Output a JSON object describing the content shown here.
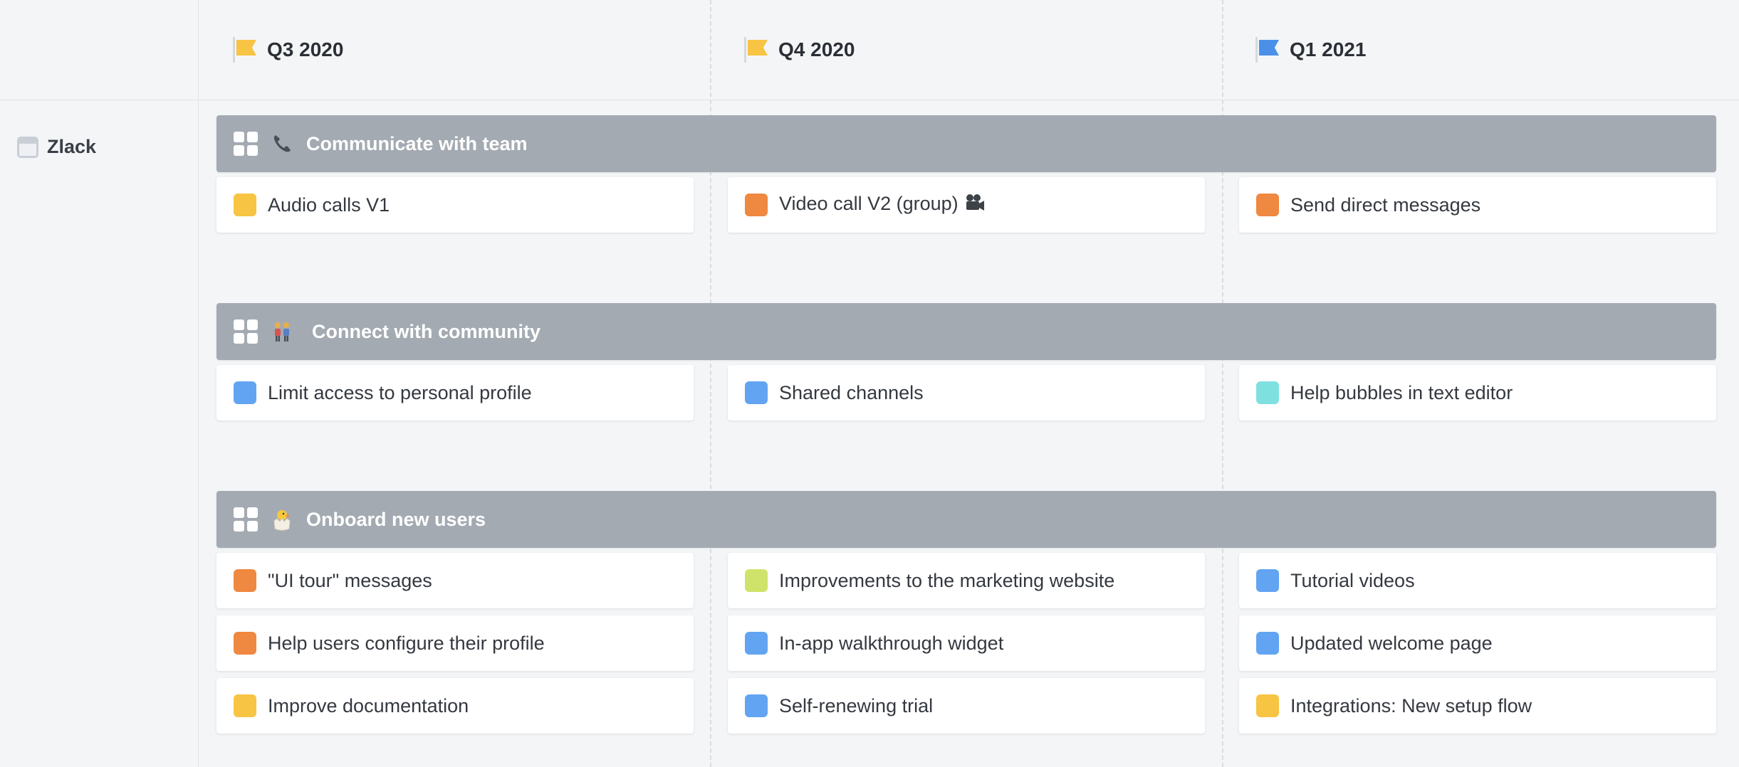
{
  "quarters": [
    {
      "label": "Q3 2020",
      "flag_color": "#f7c443"
    },
    {
      "label": "Q4 2020",
      "flag_color": "#f7c443"
    },
    {
      "label": "Q1 2021",
      "flag_color": "#4a90e8"
    }
  ],
  "product": {
    "name": "Zlack"
  },
  "initiatives": [
    {
      "title": "Communicate with team",
      "emoji": "telephone-icon",
      "features": [
        {
          "label": "Audio calls V1",
          "color": "#f7c443"
        },
        {
          "label": "Video call V2 (group)",
          "color": "#ef8840",
          "trailing_icon": "movie-camera-icon"
        },
        {
          "label": "Send direct messages",
          "color": "#ef8840"
        }
      ]
    },
    {
      "title": "Connect with community",
      "emoji": "people-icon",
      "features": [
        {
          "label": "Limit access to personal profile",
          "color": "#62a4f2"
        },
        {
          "label": "Shared channels",
          "color": "#62a4f2"
        },
        {
          "label": "Help bubbles in text editor",
          "color": "#7fe0e0"
        }
      ]
    },
    {
      "title": "Onboard new users",
      "emoji": "hatching-chick-icon",
      "features": [
        {
          "label": "\"UI tour\" messages",
          "color": "#ef8840"
        },
        {
          "label": "Improvements to the marketing website",
          "color": "#cfe36a"
        },
        {
          "label": "Tutorial videos",
          "color": "#62a4f2"
        },
        {
          "label": "Help users configure their profile",
          "color": "#ef8840"
        },
        {
          "label": "In-app walkthrough widget",
          "color": "#62a4f2"
        },
        {
          "label": "Updated welcome page",
          "color": "#62a4f2"
        },
        {
          "label": "Improve documentation",
          "color": "#f7c443"
        },
        {
          "label": "Self-renewing trial",
          "color": "#62a4f2"
        },
        {
          "label": "Integrations: New setup flow",
          "color": "#f7c443"
        }
      ]
    }
  ]
}
